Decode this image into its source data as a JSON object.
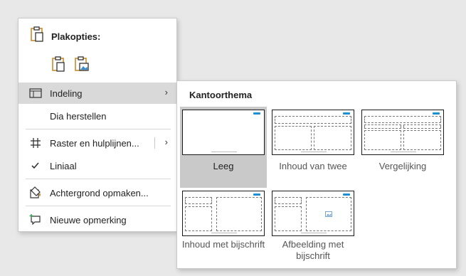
{
  "context_menu": {
    "paste_options_title": "Plakopties:",
    "paste_icons": [
      "paste-keep-formatting-icon",
      "paste-picture-icon"
    ],
    "items": [
      {
        "label": "Indeling",
        "icon": "layout-icon",
        "has_submenu": true,
        "active": true
      },
      {
        "label": "Dia herstellen",
        "icon": "",
        "has_submenu": false
      },
      {
        "label": "Raster en hulplijnen...",
        "icon": "grid-icon",
        "has_submenu": true
      },
      {
        "label": "Liniaal",
        "icon": "checkmark-icon",
        "has_submenu": false
      },
      {
        "label": "Achtergrond opmaken...",
        "icon": "format-background-icon",
        "has_submenu": false
      },
      {
        "label": "Nieuwe opmerking",
        "icon": "new-comment-icon",
        "has_submenu": false
      }
    ],
    "chevron": "›"
  },
  "layout_submenu": {
    "title": "Kantoorthema",
    "layouts": [
      {
        "name": "Leeg",
        "selected": true
      },
      {
        "name": "Inhoud van twee",
        "selected": false
      },
      {
        "name": "Vergelijking",
        "selected": false
      },
      {
        "name": "Inhoud met bijschrift",
        "selected": false
      },
      {
        "name": "Afbeelding met bijschrift",
        "selected": false
      }
    ]
  },
  "colors": {
    "accent_icon": "#c98a2b",
    "selected_bg": "#c9c9c9",
    "menu_hover": "#d9d9d9"
  }
}
